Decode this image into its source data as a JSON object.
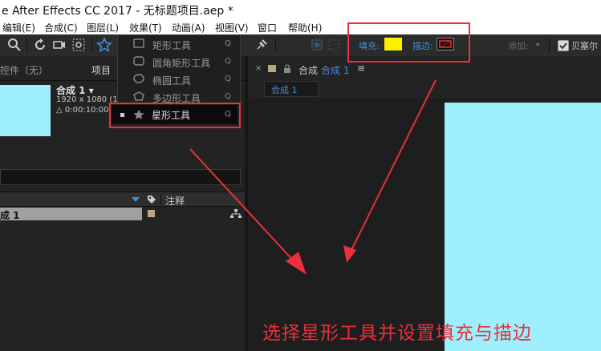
{
  "window": {
    "title": "e After Effects CC 2017 - 无标题项目.aep *"
  },
  "menubar": {
    "items": [
      "编辑(E)",
      "合成(C)",
      "图层(L)",
      "效果(T)",
      "动画(A)",
      "视图(V)",
      "窗口",
      "帮助(H)"
    ]
  },
  "toolbar": {
    "fill_label": "填充:",
    "fill_color": "#ffee00",
    "stroke_label": "描边:",
    "stroke_color": "#cc2222",
    "add_label": "添加:",
    "bezier_label": "贝塞尔"
  },
  "shape_menu": {
    "items": [
      {
        "label": "矩形工具",
        "shortcut": "Q",
        "icon": "rectangle-icon"
      },
      {
        "label": "圆角矩形工具",
        "shortcut": "Q",
        "icon": "rounded-rectangle-icon"
      },
      {
        "label": "椭圆工具",
        "shortcut": "Q",
        "icon": "ellipse-icon"
      },
      {
        "label": "多边形工具",
        "shortcut": "Q",
        "icon": "polygon-icon"
      }
    ],
    "selected": {
      "label": "星形工具",
      "shortcut": "Q",
      "icon": "star-icon"
    }
  },
  "left_panel": {
    "tab_effects": "控件（无）",
    "tab_project": "项目",
    "comp_name": "合成 1 ▾",
    "comp_size": "1920 x 1080 (1",
    "comp_duration": "△ 0:00:10:00,",
    "column_comment": "注释",
    "row_name": "成 1"
  },
  "viewer": {
    "tab_prefix": "合成",
    "tab_name": "合成 1",
    "subtab": "合成 1"
  },
  "annotation": {
    "caption": "选择星形工具并设置填充与描边"
  },
  "colors": {
    "canvas": "#9eeefc",
    "highlight": "#e8313a"
  }
}
